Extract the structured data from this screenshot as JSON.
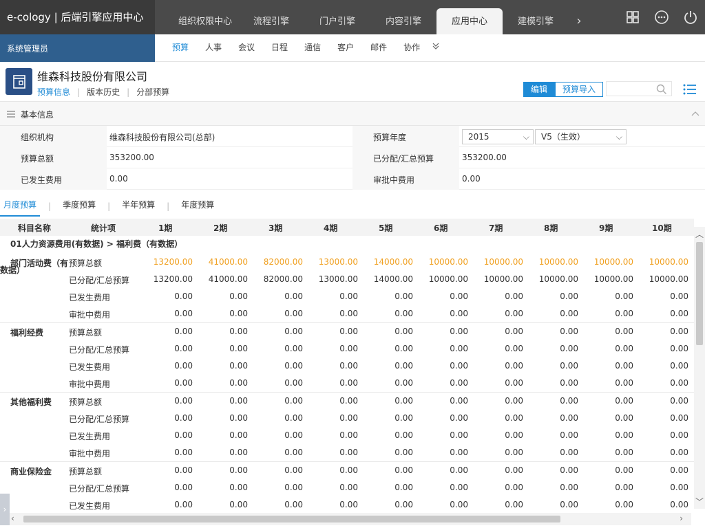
{
  "brand": "e-cology | 后端引擎应用中心",
  "top_tabs": [
    "组织权限中心",
    "流程引擎",
    "门户引擎",
    "内容引擎",
    "应用中心",
    "建模引擎"
  ],
  "top_tabs_active": "应用中心",
  "user": "系统管理员",
  "sub_nav": [
    "预算",
    "人事",
    "会议",
    "日程",
    "通信",
    "客户",
    "邮件",
    "协作"
  ],
  "company": {
    "name": "维森科技股份有限公司",
    "tabs": [
      "预算信息",
      "版本历史",
      "分部预算"
    ],
    "edit_label": "编辑",
    "import_label": "预算导入"
  },
  "section_title": "基本信息",
  "info": {
    "org_label": "组织机构",
    "org_value": "维森科技股份有限公司(总部)",
    "year_label": "预算年度",
    "year_value": "2015",
    "version_value": "V5（生效）",
    "total_label": "预算总额",
    "total_value": "353200.00",
    "allocated_label": "已分配/汇总预算",
    "allocated_value": "353200.00",
    "incurred_label": "已发生费用",
    "incurred_value": "0.00",
    "approving_label": "审批中费用",
    "approving_value": "0.00"
  },
  "period_tabs": [
    "月度预算",
    "季度预算",
    "半年预算",
    "年度预算"
  ],
  "table": {
    "headers": [
      "科目名称",
      "统计项",
      "1期",
      "2期",
      "3期",
      "4期",
      "5期",
      "6期",
      "7期",
      "8期",
      "9期",
      "10期"
    ],
    "group": "01人力资源费用(有数据) > 福利费（有数据）",
    "stat_items": [
      "预算总额",
      "已分配/汇总预算",
      "已发生费用",
      "审批中费用"
    ],
    "subjects": [
      {
        "name_line1": "部门活动费（有",
        "name_line2": "数据）",
        "rows": [
          [
            "13200.00",
            "41000.00",
            "82000.00",
            "13000.00",
            "14000.00",
            "10000.00",
            "10000.00",
            "10000.00",
            "10000.00",
            "10000.00"
          ],
          [
            "13200.00",
            "41000.00",
            "82000.00",
            "13000.00",
            "14000.00",
            "10000.00",
            "10000.00",
            "10000.00",
            "10000.00",
            "10000.00"
          ],
          [
            "0.00",
            "0.00",
            "0.00",
            "0.00",
            "0.00",
            "0.00",
            "0.00",
            "0.00",
            "0.00",
            "0.00"
          ],
          [
            "0.00",
            "0.00",
            "0.00",
            "0.00",
            "0.00",
            "0.00",
            "0.00",
            "0.00",
            "0.00",
            "0.00"
          ]
        ]
      },
      {
        "name_line1": "福利经费",
        "name_line2": "",
        "rows": [
          [
            "0.00",
            "0.00",
            "0.00",
            "0.00",
            "0.00",
            "0.00",
            "0.00",
            "0.00",
            "0.00",
            "0.00"
          ],
          [
            "0.00",
            "0.00",
            "0.00",
            "0.00",
            "0.00",
            "0.00",
            "0.00",
            "0.00",
            "0.00",
            "0.00"
          ],
          [
            "0.00",
            "0.00",
            "0.00",
            "0.00",
            "0.00",
            "0.00",
            "0.00",
            "0.00",
            "0.00",
            "0.00"
          ],
          [
            "0.00",
            "0.00",
            "0.00",
            "0.00",
            "0.00",
            "0.00",
            "0.00",
            "0.00",
            "0.00",
            "0.00"
          ]
        ]
      },
      {
        "name_line1": "其他福利费",
        "name_line2": "",
        "rows": [
          [
            "0.00",
            "0.00",
            "0.00",
            "0.00",
            "0.00",
            "0.00",
            "0.00",
            "0.00",
            "0.00",
            "0.00"
          ],
          [
            "0.00",
            "0.00",
            "0.00",
            "0.00",
            "0.00",
            "0.00",
            "0.00",
            "0.00",
            "0.00",
            "0.00"
          ],
          [
            "0.00",
            "0.00",
            "0.00",
            "0.00",
            "0.00",
            "0.00",
            "0.00",
            "0.00",
            "0.00",
            "0.00"
          ],
          [
            "0.00",
            "0.00",
            "0.00",
            "0.00",
            "0.00",
            "0.00",
            "0.00",
            "0.00",
            "0.00",
            "0.00"
          ]
        ]
      },
      {
        "name_line1": "商业保险金",
        "name_line2": "",
        "rows": [
          [
            "0.00",
            "0.00",
            "0.00",
            "0.00",
            "0.00",
            "0.00",
            "0.00",
            "0.00",
            "0.00",
            "0.00"
          ],
          [
            "0.00",
            "0.00",
            "0.00",
            "0.00",
            "0.00",
            "0.00",
            "0.00",
            "0.00",
            "0.00",
            "0.00"
          ],
          [
            "0.00",
            "0.00",
            "0.00",
            "0.00",
            "0.00",
            "0.00",
            "0.00",
            "0.00",
            "0.00",
            "0.00"
          ]
        ]
      }
    ]
  },
  "colors": {
    "accent": "#1f8bd6",
    "highlight": "#f0a020",
    "topbar": "#4a4a4a",
    "userbox": "#2f5f8e"
  }
}
